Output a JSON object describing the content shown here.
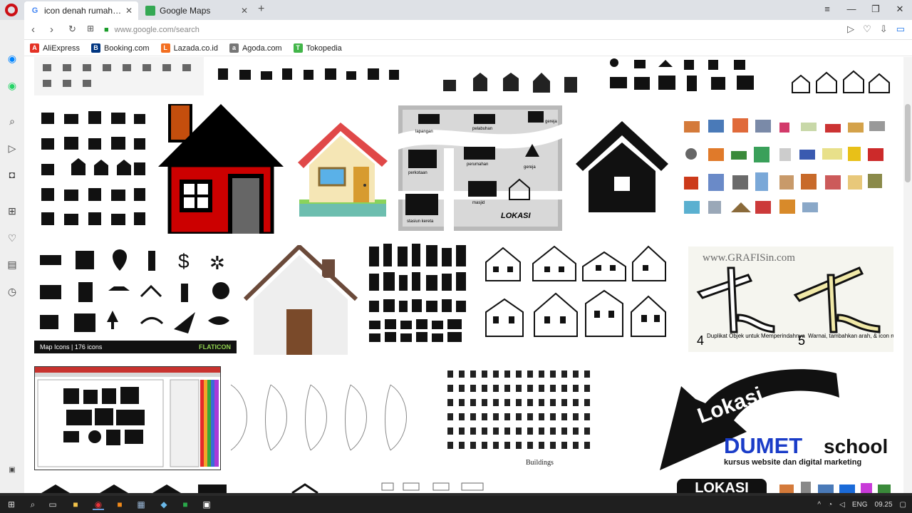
{
  "tabs": [
    {
      "title": "icon denah rumah - Googl",
      "favicon": "G",
      "color": "#4285f4"
    },
    {
      "title": "Google Maps",
      "favicon": "map-icon",
      "color": "#34a853"
    }
  ],
  "address": {
    "url": "www.google.com/search"
  },
  "bookmarks": [
    {
      "label": "AliExpress",
      "color": "#e43225",
      "glyph": "A"
    },
    {
      "label": "Booking.com",
      "color": "#003580",
      "glyph": "B"
    },
    {
      "label": "Lazada.co.id",
      "color": "#f36f21",
      "glyph": "L"
    },
    {
      "label": "Agoda.com",
      "color": "#777777",
      "glyph": "a"
    },
    {
      "label": "Tokopedia",
      "color": "#42b549",
      "glyph": "T"
    }
  ],
  "results": {
    "map_icons_caption": "Map Icons | 176 icons",
    "flaticon_brand": "FLATICON",
    "grafis_url": "www.GRAFISin.com",
    "grafis_step4": "Duplikat Objek untuk Memperindahnya",
    "grafis_step5": "Warnai, tambahkan arah, & icon rumah, dll.",
    "grafis_num4": "4",
    "grafis_num5": "5",
    "lokasi_big": "Lokasi",
    "lokasi_small": "LOKASI",
    "dumet_brand": "DUMET",
    "dumet_brand2": "school",
    "dumet_tagline": "kursus website dan digital marketing",
    "buildings_caption": "Buildings",
    "map_labels": [
      "lapangan",
      "pelabuhan",
      "gereja",
      "perkotaan",
      "perumahan",
      "gereja",
      "stasiun kereta",
      "masjid"
    ],
    "lokasi_map_label": "LOKASI"
  },
  "taskbar": {
    "language": "ENG",
    "time": "09.25"
  },
  "colors": {
    "house_red": "#cc0000",
    "house_roof": "#e04848",
    "house_wall": "#f5e6b5",
    "dumet_blue": "#1a3cc8"
  }
}
